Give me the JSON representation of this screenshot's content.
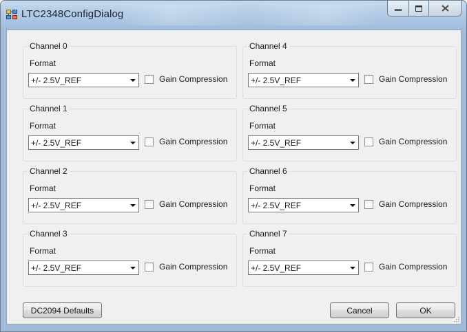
{
  "window": {
    "title": "LTC2348ConfigDialog",
    "icon": "app-icon",
    "caption_buttons": [
      "minimize-icon",
      "maximize-icon",
      "close-icon"
    ]
  },
  "channels": [
    {
      "legend": "Channel 0",
      "format_label": "Format",
      "format_value": "+/- 2.5V_REF",
      "checkbox_label": "Gain Compression",
      "checked": false
    },
    {
      "legend": "Channel 1",
      "format_label": "Format",
      "format_value": "+/- 2.5V_REF",
      "checkbox_label": "Gain Compression",
      "checked": false
    },
    {
      "legend": "Channel 2",
      "format_label": "Format",
      "format_value": "+/- 2.5V_REF",
      "checkbox_label": "Gain Compression",
      "checked": false
    },
    {
      "legend": "Channel 3",
      "format_label": "Format",
      "format_value": "+/- 2.5V_REF",
      "checkbox_label": "Gain Compression",
      "checked": false
    },
    {
      "legend": "Channel 4",
      "format_label": "Format",
      "format_value": "+/- 2.5V_REF",
      "checkbox_label": "Gain Compression",
      "checked": false
    },
    {
      "legend": "Channel 5",
      "format_label": "Format",
      "format_value": "+/- 2.5V_REF",
      "checkbox_label": "Gain Compression",
      "checked": false
    },
    {
      "legend": "Channel 6",
      "format_label": "Format",
      "format_value": "+/- 2.5V_REF",
      "checkbox_label": "Gain Compression",
      "checked": false
    },
    {
      "legend": "Channel 7",
      "format_label": "Format",
      "format_value": "+/- 2.5V_REF",
      "checkbox_label": "Gain Compression",
      "checked": false
    }
  ],
  "buttons": {
    "defaults": "DC2094 Defaults",
    "cancel": "Cancel",
    "ok": "OK"
  }
}
